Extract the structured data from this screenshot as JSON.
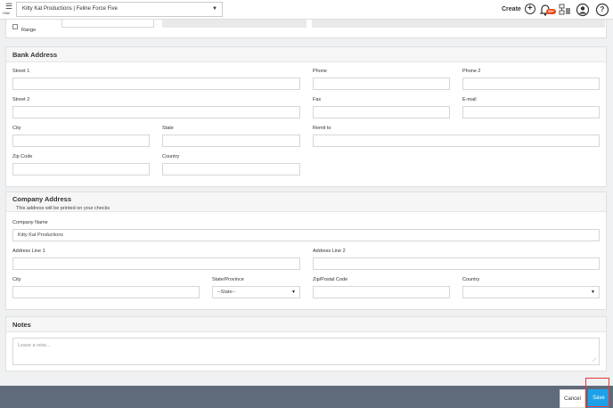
{
  "topbar": {
    "hide_label": "Hide",
    "company": "Kitty Kat Productions | Feline Force Five",
    "create_label": "Create",
    "notification_badge": "99+",
    "help_label": "?"
  },
  "range_section": {
    "range_label": "Range"
  },
  "bank_address": {
    "title": "Bank Address",
    "street1_label": "Street 1",
    "street2_label": "Street 2",
    "city_label": "City",
    "state_label": "State",
    "zip_label": "Zip Code",
    "country_label": "Country",
    "phone_label": "Phone",
    "phone2_label": "Phone 2",
    "fax_label": "Fax",
    "email_label": "E-mail",
    "remit_label": "Remit to"
  },
  "company_address": {
    "title": "Company Address",
    "subtitle": "This address will be printed on your checks",
    "name_label": "Company Name",
    "name_value": "Kitty Kat Productions",
    "line1_label": "Address Line 1",
    "line2_label": "Address Line 2",
    "city_label": "City",
    "state_label": "State/Province",
    "state_value": "--State--",
    "zip_label": "Zip/Postal Code",
    "country_label": "Country"
  },
  "notes": {
    "title": "Notes",
    "placeholder": "Leave a note..."
  },
  "footer": {
    "cancel_label": "Cancel",
    "save_label": "Save"
  },
  "colors": {
    "accent": "#1ea0e8",
    "footer_bg": "#5f6b7a",
    "highlight": "#e53935"
  }
}
